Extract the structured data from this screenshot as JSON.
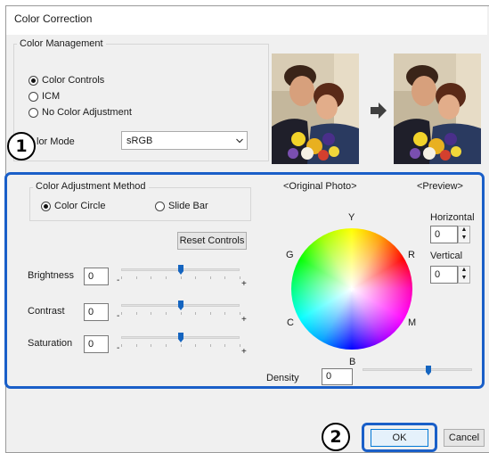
{
  "window": {
    "title": "Color Correction"
  },
  "color_management": {
    "legend": "Color Management",
    "options": [
      {
        "label": "Color Controls",
        "selected": true
      },
      {
        "label": "ICM",
        "selected": false
      },
      {
        "label": "No Color Adjustment",
        "selected": false
      }
    ],
    "color_mode_label": "lor Mode",
    "color_mode_value": "sRGB",
    "arrow_icon": "right-arrow-icon"
  },
  "adjustment": {
    "legend": "Color Adjustment Method",
    "methods": [
      {
        "label": "Color Circle",
        "selected": true
      },
      {
        "label": "Slide Bar",
        "selected": false
      }
    ],
    "reset_label": "Reset Controls",
    "sliders": [
      {
        "label": "Brightness",
        "value": "0",
        "level": 0.5,
        "minus": "-",
        "plus": "+"
      },
      {
        "label": "Contrast",
        "value": "0",
        "level": 0.5,
        "minus": "-",
        "plus": "+"
      },
      {
        "label": "Saturation",
        "value": "0",
        "level": 0.5,
        "minus": "-",
        "plus": "+"
      }
    ]
  },
  "preview": {
    "original_label": "<Original Photo>",
    "preview_label": "<Preview>",
    "wheel_letters": {
      "y": "Y",
      "r": "R",
      "m": "M",
      "b": "B",
      "c": "C",
      "g": "G"
    },
    "center_mark": "+",
    "horizontal_label": "Horizontal",
    "horizontal_value": "0",
    "vertical_label": "Vertical",
    "vertical_value": "0",
    "density_label": "Density",
    "density_value": "0",
    "density_level": 0.6
  },
  "buttons": {
    "ok": "OK",
    "cancel": "Cancel"
  },
  "callouts": {
    "one": "1",
    "two": "2"
  },
  "colors": {
    "highlight": "#1a5fc8",
    "slider_thumb": "#1565c0"
  }
}
